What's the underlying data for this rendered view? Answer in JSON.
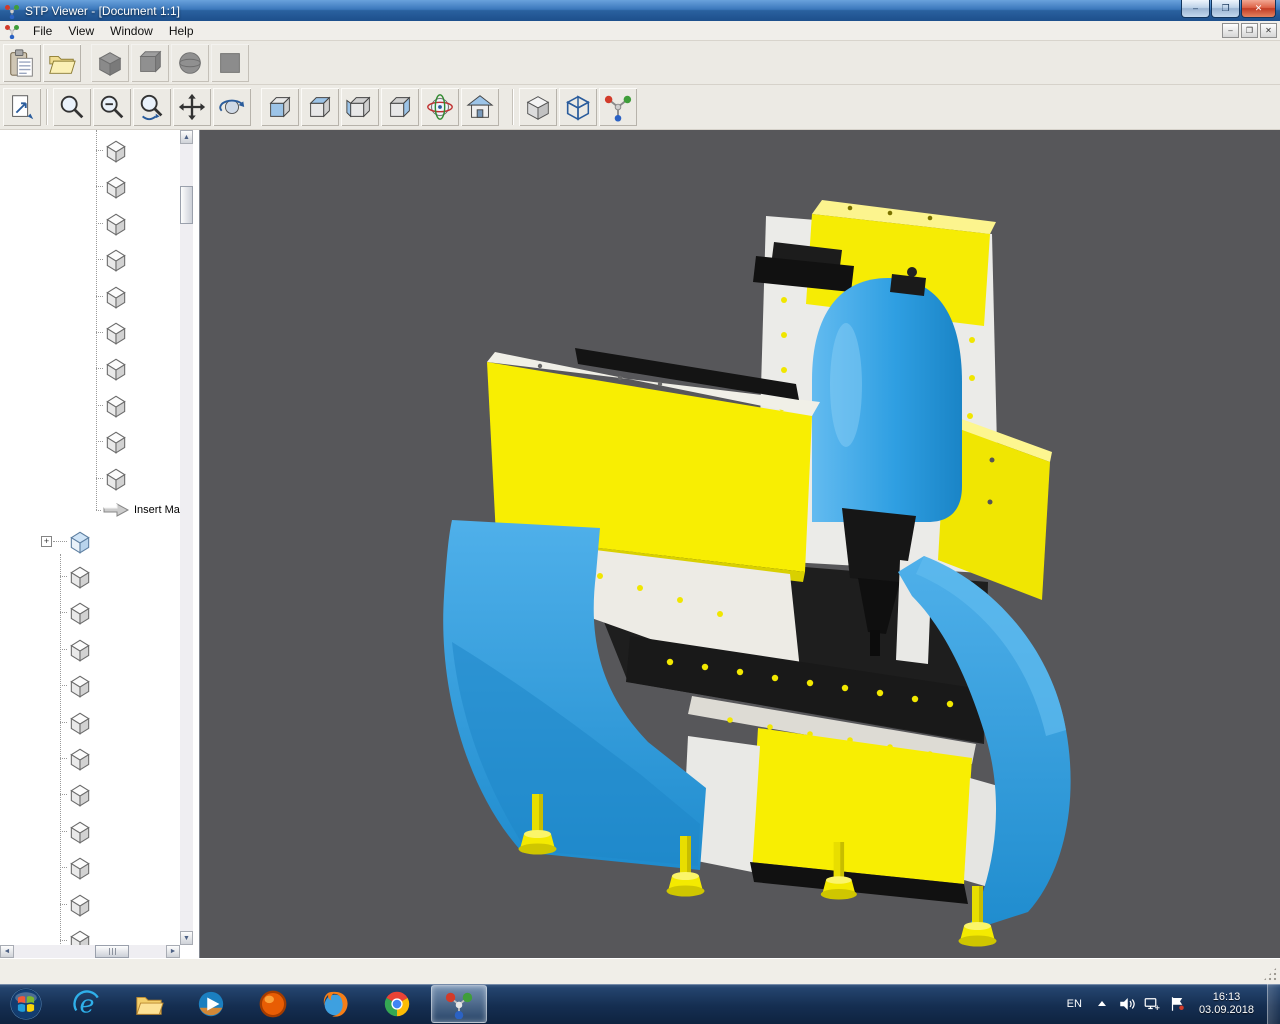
{
  "window": {
    "title": "STP Viewer - [Document 1:1]",
    "icon": "stp-viewer-app-icon"
  },
  "titlebar_controls": [
    {
      "name": "minimize",
      "glyph": "–"
    },
    {
      "name": "maximize",
      "glyph": "❐"
    },
    {
      "name": "close",
      "glyph": "✕"
    }
  ],
  "menu": {
    "items": [
      {
        "label": "File"
      },
      {
        "label": "View"
      },
      {
        "label": "Window"
      },
      {
        "label": "Help"
      }
    ]
  },
  "mdi_controls": [
    {
      "name": "mdi-minimize",
      "glyph": "–"
    },
    {
      "name": "mdi-restore",
      "glyph": "❐"
    },
    {
      "name": "mdi-close",
      "glyph": "✕"
    }
  ],
  "toolbar_file": {
    "buttons": [
      {
        "name": "paste",
        "icon": "clipboard-icon",
        "enabled": true
      },
      {
        "name": "open",
        "icon": "folder-open-icon",
        "enabled": true
      },
      {
        "name": "solid-box",
        "icon": "solid-box-icon",
        "enabled": false
      },
      {
        "name": "solid-cube",
        "icon": "solid-cube-icon",
        "enabled": false
      },
      {
        "name": "solid-sphere",
        "icon": "solid-sphere-icon",
        "enabled": false
      },
      {
        "name": "solid-square",
        "icon": "solid-square-icon",
        "enabled": false
      }
    ]
  },
  "toolbar_view": {
    "buttons": [
      {
        "name": "fit-to-window",
        "icon": "fit-page-icon"
      },
      {
        "name": "zoom",
        "icon": "magnifier-icon"
      },
      {
        "name": "zoom-window",
        "icon": "magnifier-minus-icon"
      },
      {
        "name": "zoom-dynamic",
        "icon": "magnifier-arrow-icon"
      },
      {
        "name": "pan",
        "icon": "pan-arrows-icon"
      },
      {
        "name": "rotate",
        "icon": "orbit-icon"
      },
      {
        "name": "view-front",
        "icon": "view-front-icon"
      },
      {
        "name": "view-back",
        "icon": "view-back-icon"
      },
      {
        "name": "view-left",
        "icon": "view-left-icon"
      },
      {
        "name": "view-right",
        "icon": "view-right-icon"
      },
      {
        "name": "view-perspective",
        "icon": "globe-icon"
      },
      {
        "name": "view-home",
        "icon": "home-icon"
      },
      {
        "name": "display-shaded",
        "icon": "shaded-box-icon"
      },
      {
        "name": "display-wireframe",
        "icon": "wireframe-box-icon"
      },
      {
        "name": "display-axes",
        "icon": "axes-triad-icon"
      }
    ]
  },
  "tree": {
    "group1_count": 10,
    "insert_node_label": "Insert Ma",
    "group2_count": 11
  },
  "viewport": {
    "background": "#57575a",
    "model": "cnc-milling-machine"
  },
  "model_colors": {
    "yellow": "#f8ee02",
    "blue": "#2f9fe2",
    "blue_dark": "#1f86c8",
    "white": "#edebe5",
    "black": "#161616"
  },
  "statusbar": {
    "text": ""
  },
  "taskbar": {
    "start": "start-orb",
    "apps": [
      {
        "name": "internet-explorer",
        "icon": "ie-icon"
      },
      {
        "name": "windows-explorer",
        "icon": "folder-icon"
      },
      {
        "name": "media-player",
        "icon": "media-player-icon"
      },
      {
        "name": "browser-orange",
        "icon": "orange-browser-icon"
      },
      {
        "name": "firefox",
        "icon": "firefox-icon"
      },
      {
        "name": "chrome",
        "icon": "chrome-icon"
      },
      {
        "name": "stp-viewer",
        "icon": "stp-viewer-icon",
        "active": true
      }
    ],
    "tray": {
      "language": "EN",
      "time": "16:13",
      "date": "03.09.2018"
    }
  }
}
